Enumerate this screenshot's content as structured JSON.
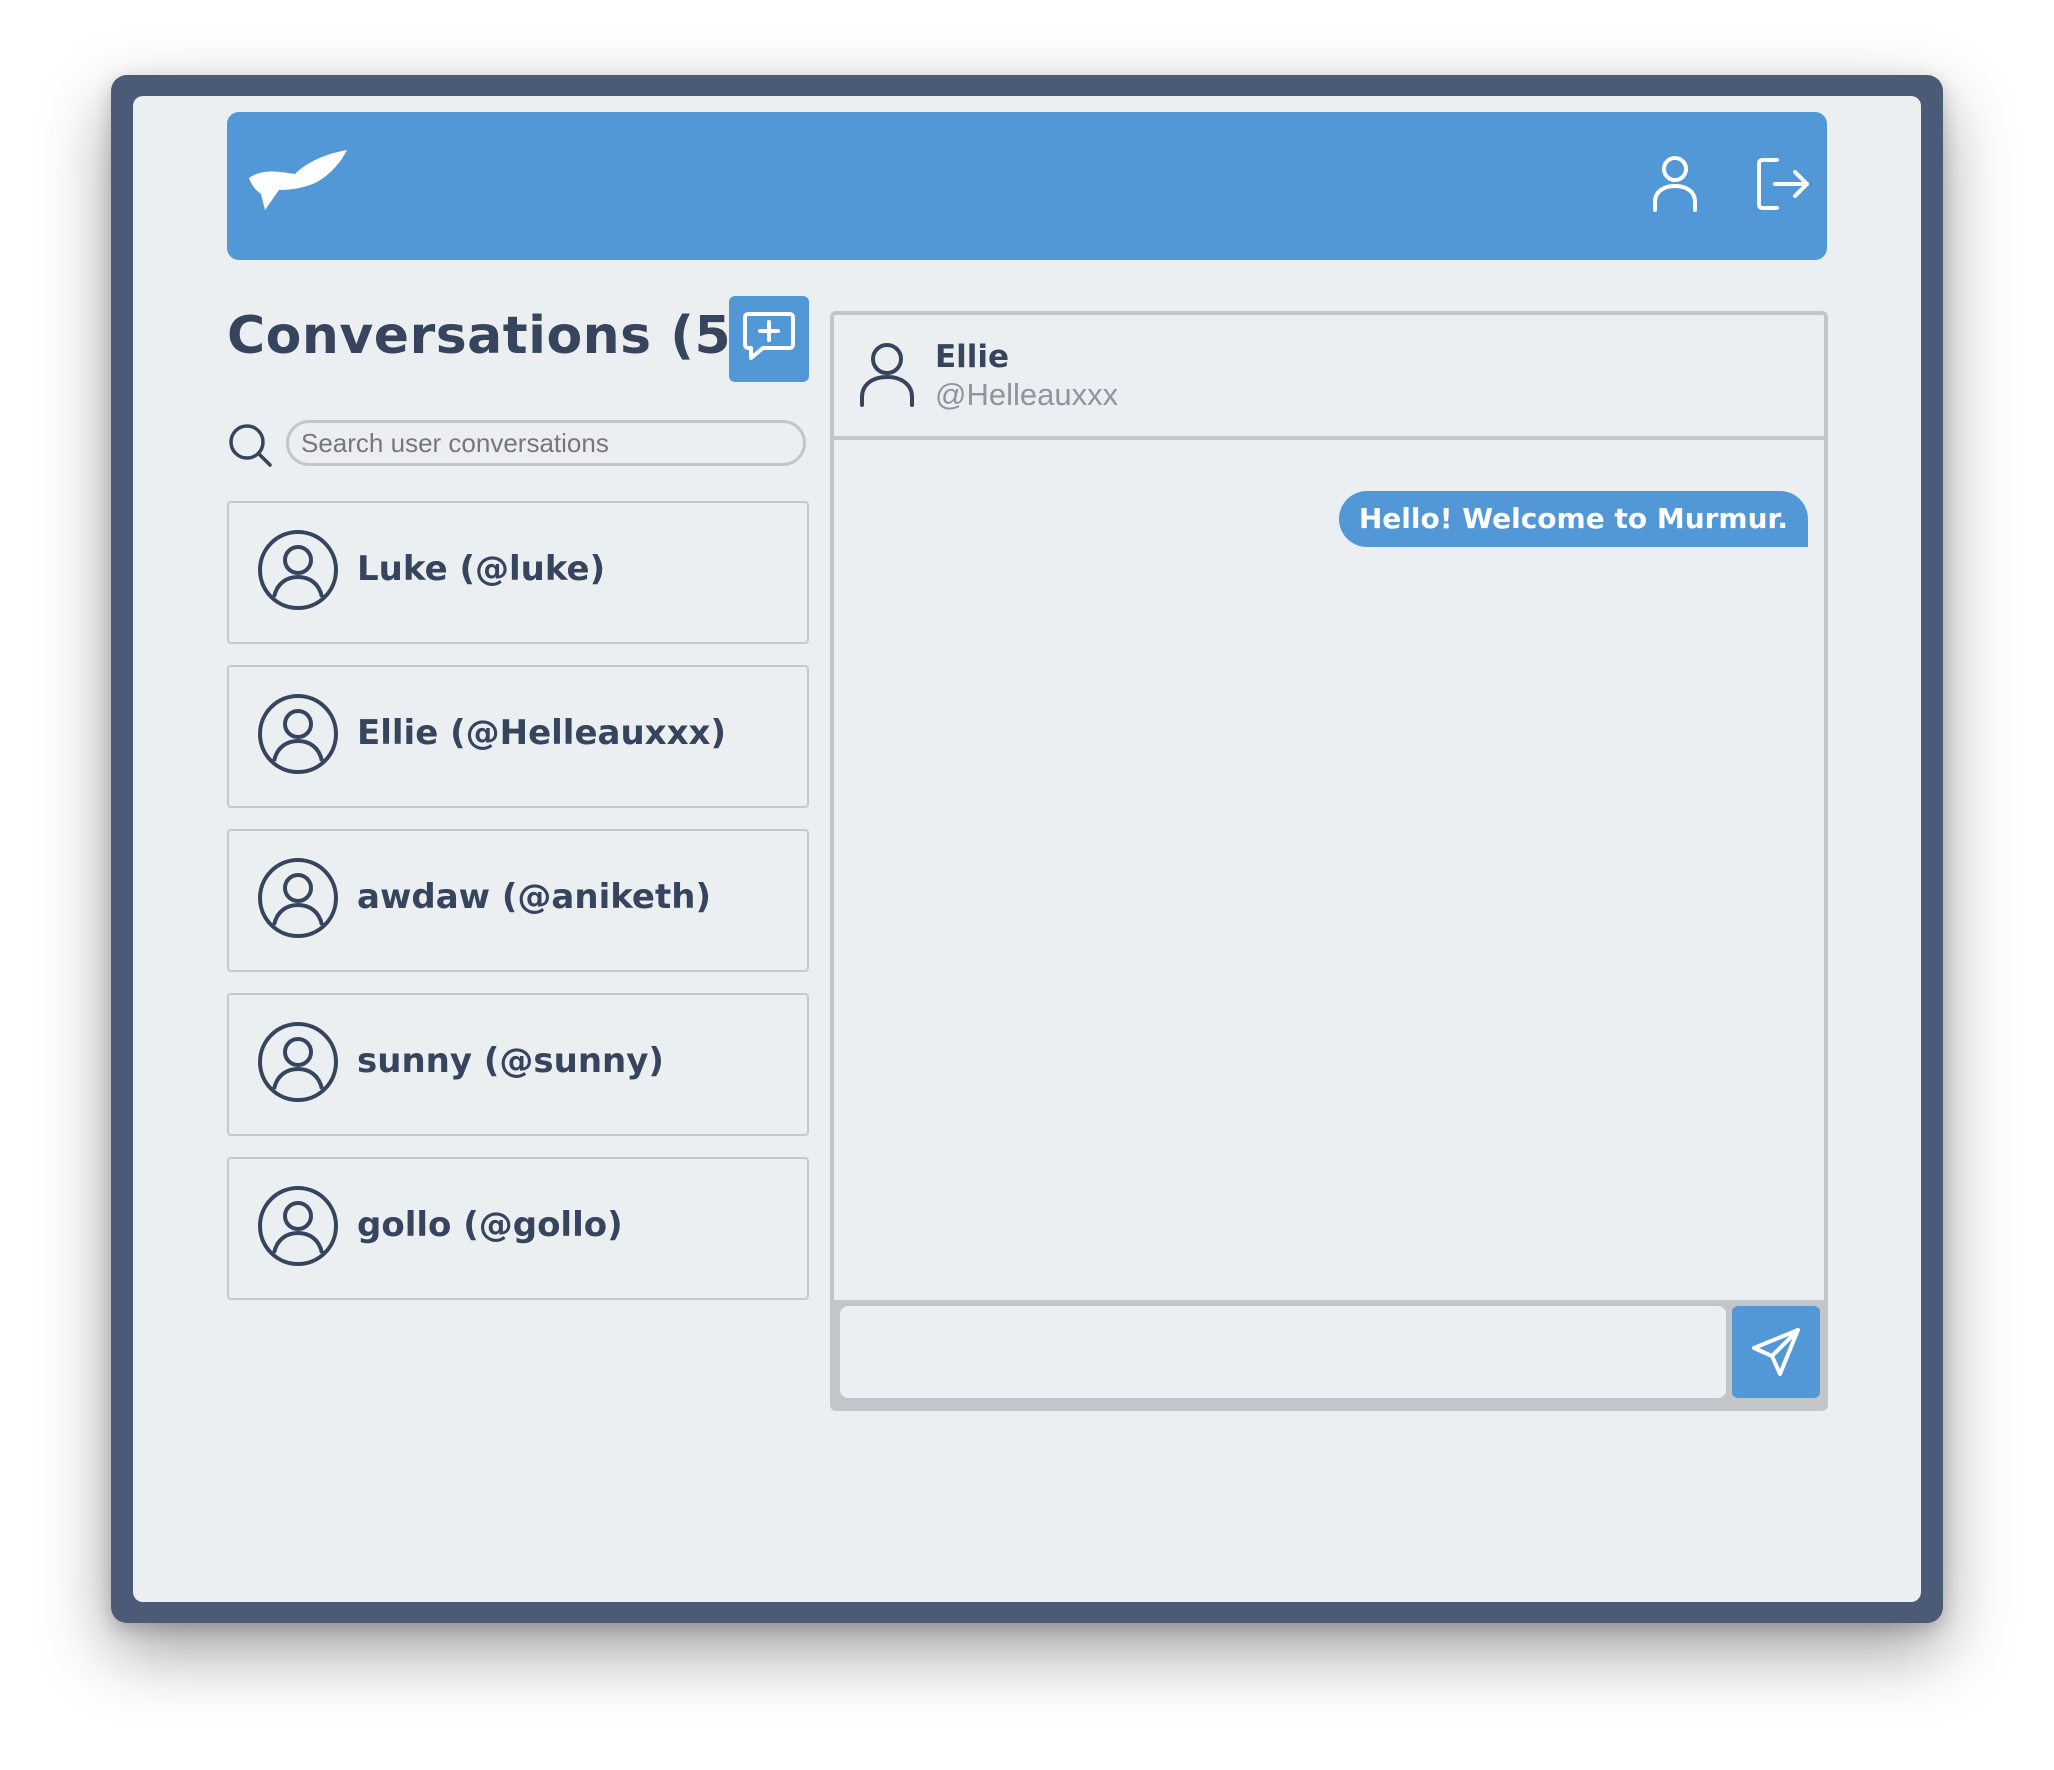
{
  "header": {
    "logo_icon": "bird-logo-icon",
    "profile_icon": "user-icon",
    "logout_icon": "logout-icon",
    "background_color": "#5297d6"
  },
  "sidebar": {
    "title": "Conversations (5)",
    "new_conversation_icon": "message-plus-icon",
    "search": {
      "placeholder": "Search user conversations",
      "value": ""
    },
    "conversations": [
      {
        "label": "Luke (@luke)"
      },
      {
        "label": "Ellie (@Helleauxxx)"
      },
      {
        "label": "awdaw (@aniketh)"
      },
      {
        "label": "sunny (@sunny)"
      },
      {
        "label": "gollo (@gollo)"
      }
    ]
  },
  "chat": {
    "name": "Ellie",
    "handle": "@Helleauxxx",
    "messages": [
      {
        "text": "Hello! Welcome to Murmur.",
        "outgoing": true
      }
    ],
    "composer": {
      "value": "",
      "send_icon": "send-icon"
    }
  },
  "colors": {
    "accent": "#5297d6",
    "text_dark": "#36445d",
    "text_muted": "#8e959e",
    "frame": "#4a5a77",
    "background": "#eceff1"
  }
}
